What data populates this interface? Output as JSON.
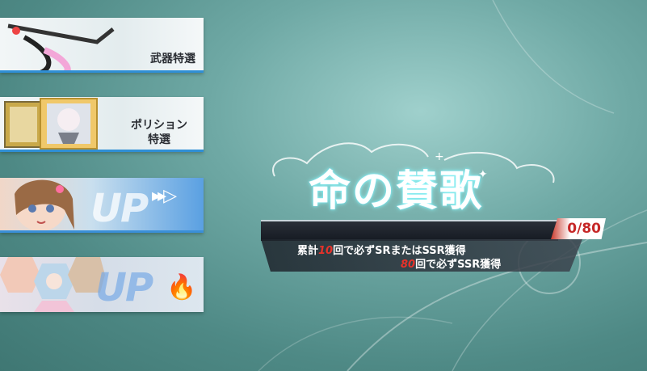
{
  "banners": [
    {
      "label": "武器特選"
    },
    {
      "label_line1": "ポリション",
      "label_line2": "特選"
    },
    {
      "up_text": "UP",
      "arrows": "▸▸▷"
    },
    {
      "up_text": "UP",
      "flame": "🔥"
    }
  ],
  "event": {
    "title": "命の賛歌",
    "counter": "0/80",
    "line1_prefix": "累計",
    "line1_number": "10",
    "line1_suffix": "回で必ずSRまたはSSR獲得",
    "line2_number": "80",
    "line2_suffix": "回で必ずSSR獲得"
  },
  "colors": {
    "accent_blue": "#2f8fd6",
    "counter_red": "#c62828",
    "highlight_red": "#e8322a"
  }
}
